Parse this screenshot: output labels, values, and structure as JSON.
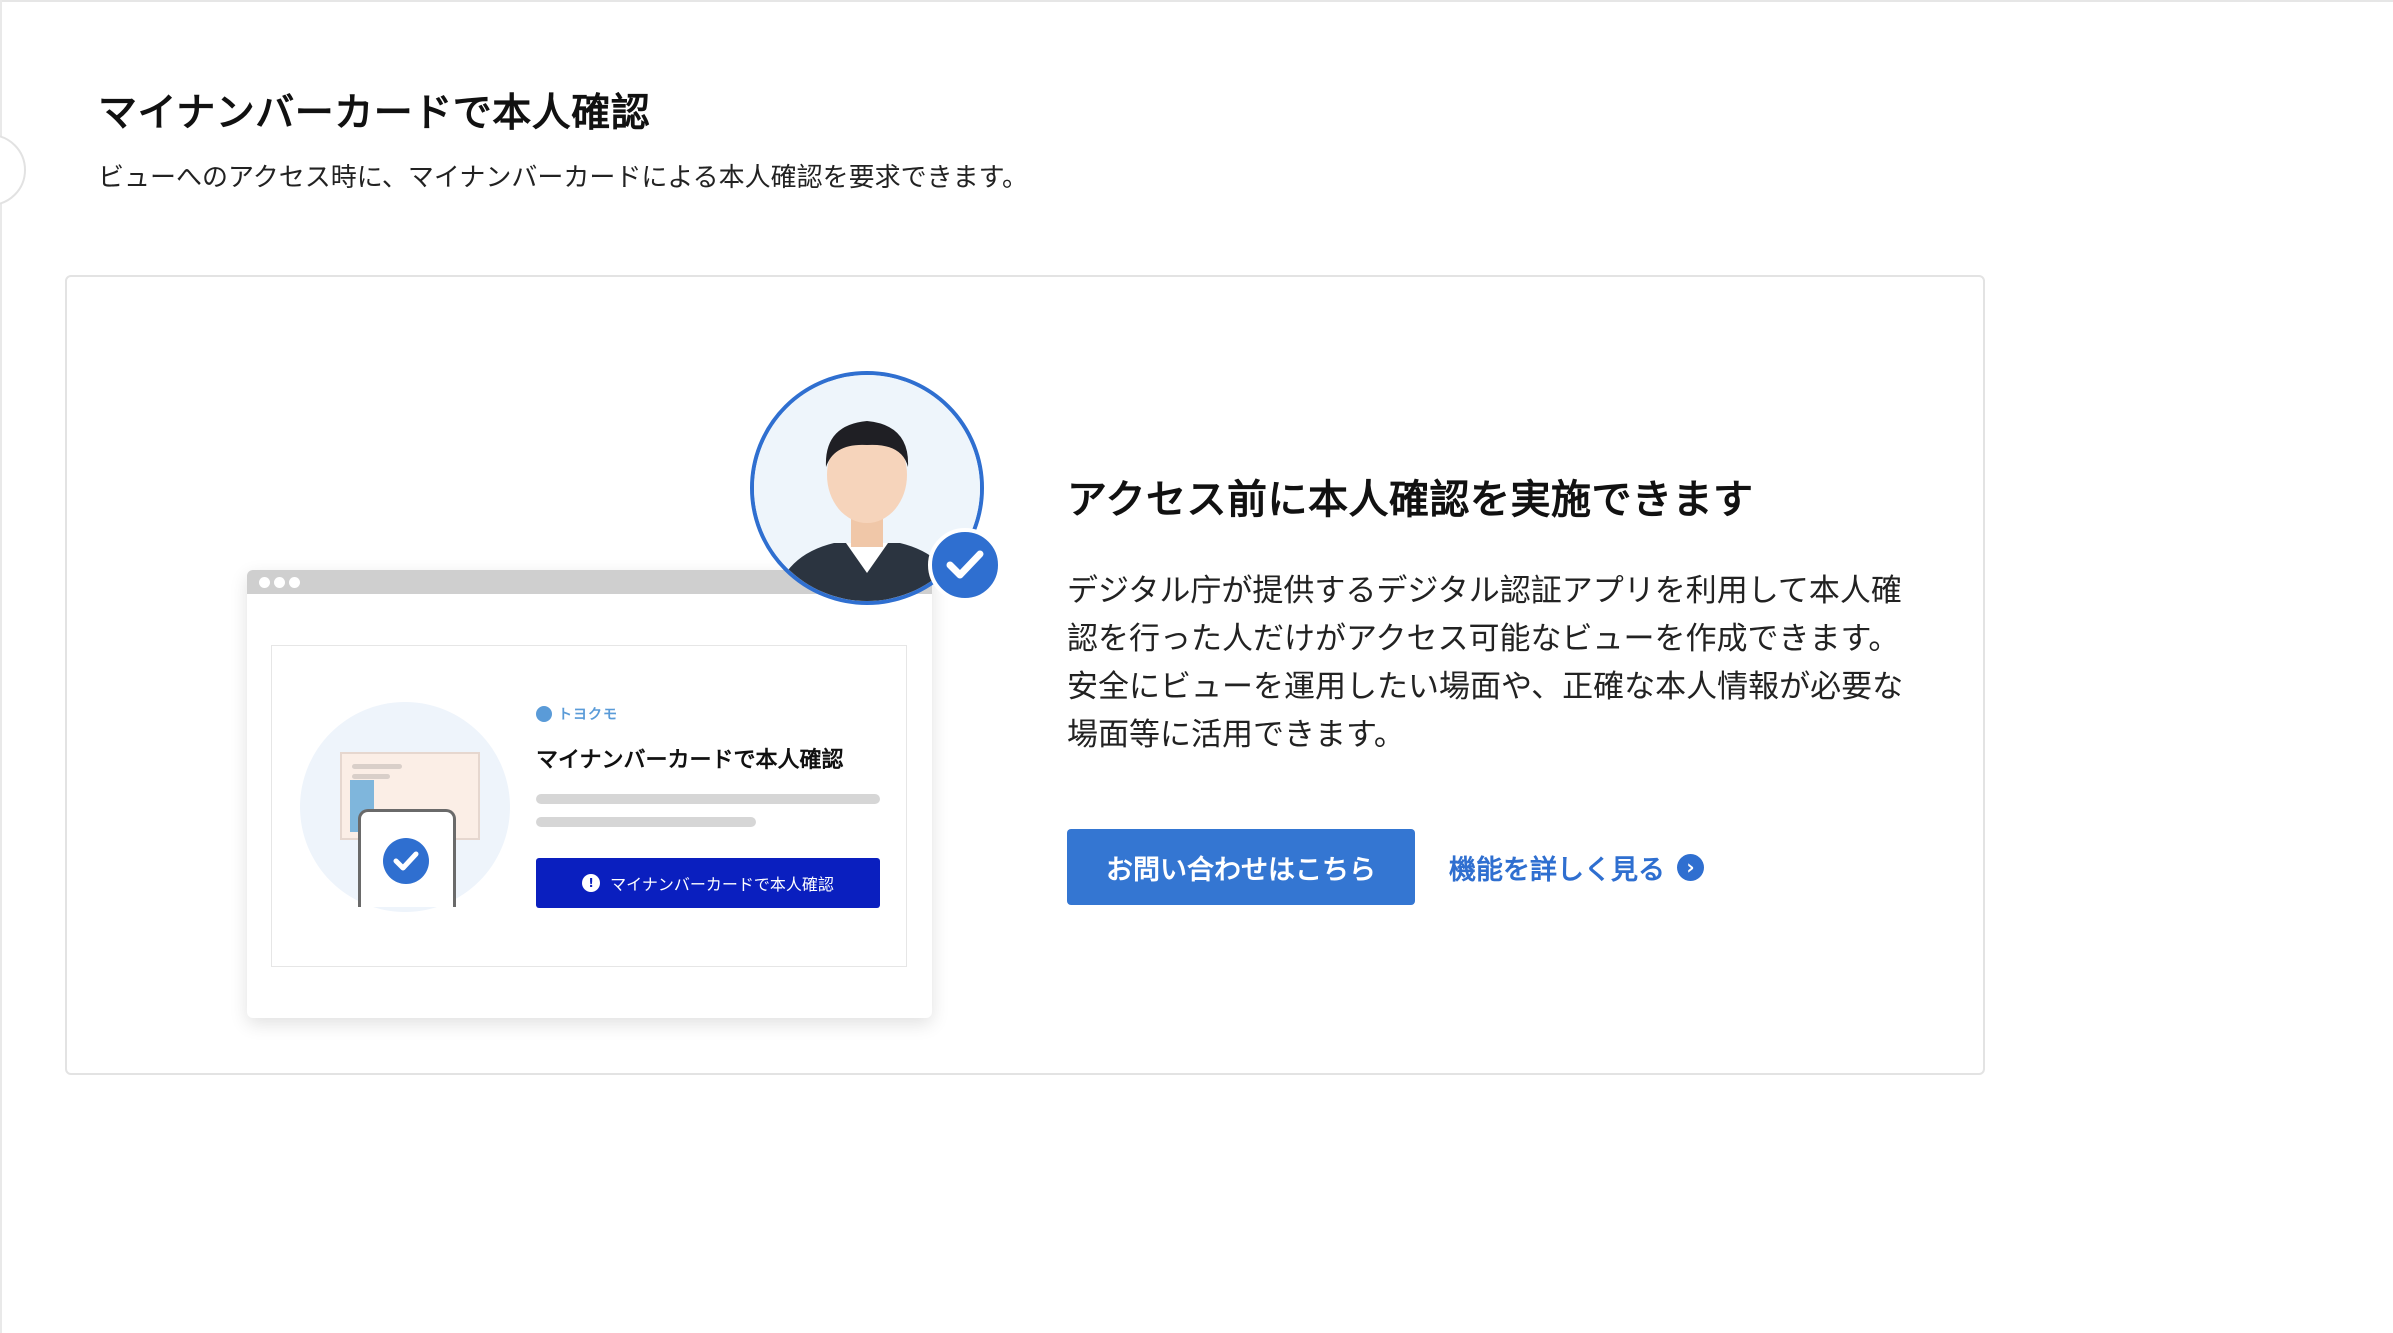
{
  "page": {
    "title": "マイナンバーカードで本人確認",
    "description": "ビューへのアクセス時に、マイナンバーカードによる本人確認を要求できます。"
  },
  "illustration": {
    "brand_name": "トヨクモ",
    "mini_title": "マイナンバーカードで本人確認",
    "mini_button_label": "マイナンバーカードで本人確認",
    "mini_button_icon": "shield-icon",
    "accent_color": "#2f6fd0",
    "button_color": "#0a1fbf"
  },
  "feature": {
    "title": "アクセス前に本人確認を実施できます",
    "body": "デジタル庁が提供するデジタル認証アプリを利用して本人確認を行った人だけがアクセス可能なビューを作成できます。安全にビューを運用したい場面や、正確な本人情報が必要な場面等に活用できます。",
    "contact_button": "お問い合わせはこちら",
    "more_link": "機能を詳しく見る",
    "more_link_icon": "chevron-right-circle-icon",
    "button_color": "#3476d2"
  }
}
